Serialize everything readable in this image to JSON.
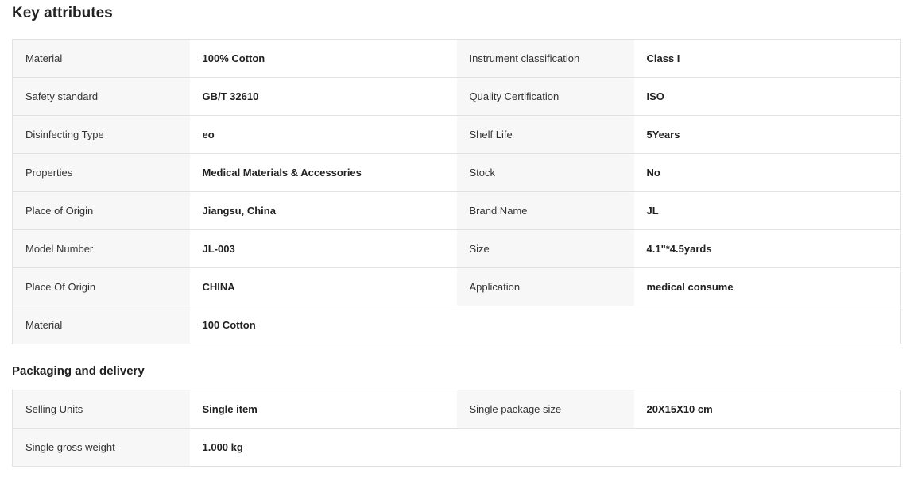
{
  "key_attributes": {
    "title": "Key attributes",
    "rows": [
      [
        {
          "label": "Material",
          "value": "100% Cotton"
        },
        {
          "label": "Instrument classification",
          "value": "Class I"
        }
      ],
      [
        {
          "label": "Safety standard",
          "value": "GB/T 32610"
        },
        {
          "label": "Quality Certification",
          "value": "ISO"
        }
      ],
      [
        {
          "label": "Disinfecting Type",
          "value": "eo"
        },
        {
          "label": "Shelf Life",
          "value": "5Years"
        }
      ],
      [
        {
          "label": "Properties",
          "value": "Medical Materials & Accessories"
        },
        {
          "label": "Stock",
          "value": "No"
        }
      ],
      [
        {
          "label": "Place of Origin",
          "value": "Jiangsu, China"
        },
        {
          "label": "Brand Name",
          "value": "JL"
        }
      ],
      [
        {
          "label": "Model Number",
          "value": "JL-003"
        },
        {
          "label": "Size",
          "value": "4.1\"*4.5yards"
        }
      ],
      [
        {
          "label": "Place Of Origin",
          "value": "CHINA"
        },
        {
          "label": "Application",
          "value": "medical consume"
        }
      ],
      [
        {
          "label": "Material",
          "value": "100 Cotton"
        }
      ]
    ]
  },
  "packaging": {
    "title": "Packaging and delivery",
    "rows": [
      [
        {
          "label": "Selling Units",
          "value": "Single item"
        },
        {
          "label": "Single package size",
          "value": "20X15X10 cm"
        }
      ],
      [
        {
          "label": "Single gross weight",
          "value": "1.000 kg"
        }
      ]
    ]
  }
}
